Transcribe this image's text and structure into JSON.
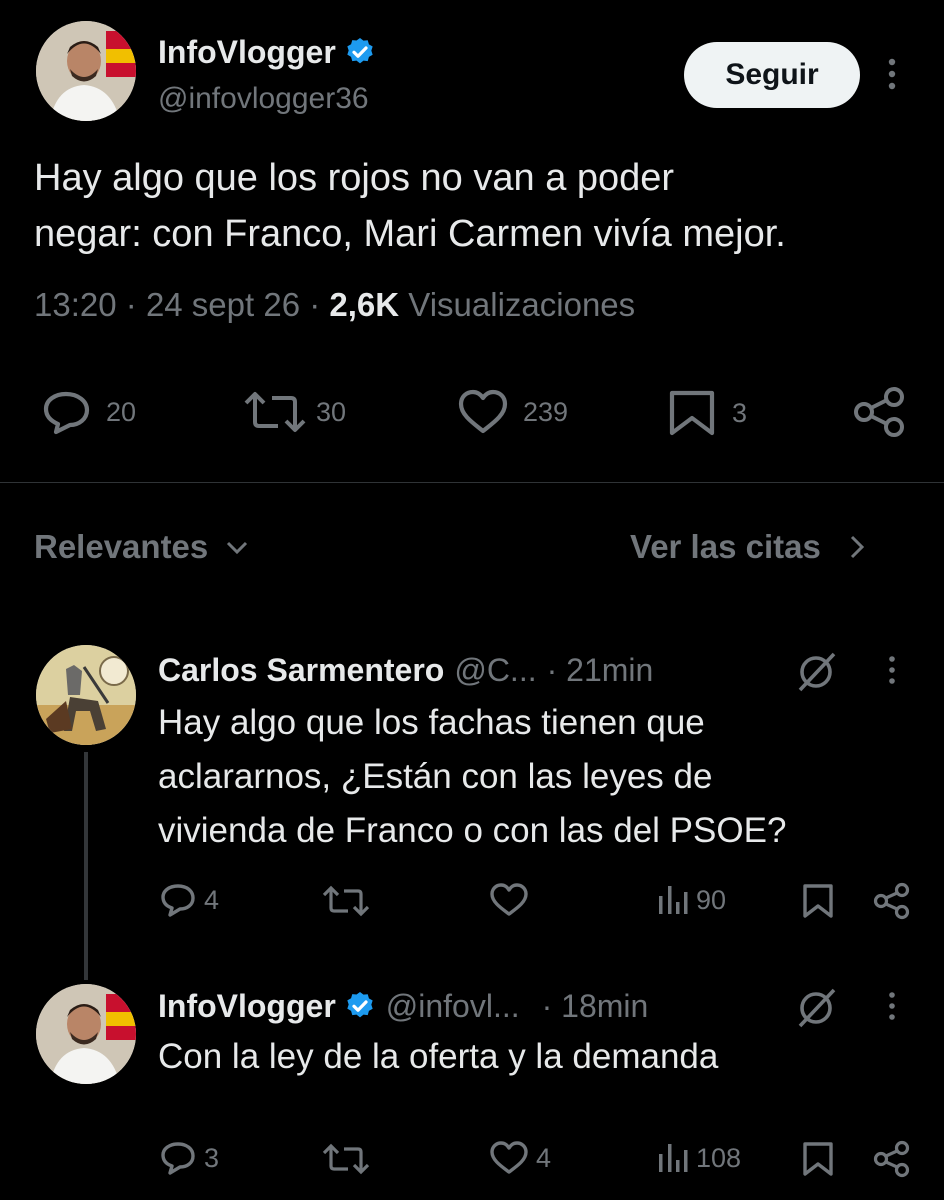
{
  "tweet": {
    "author_name": "InfoVlogger",
    "handle": "@infovlogger36",
    "follow_label": "Seguir",
    "text_line1": "Hay algo que los rojos no van a poder",
    "text_line2": "negar: con Franco, Mari Carmen vivía mejor.",
    "time": "13:20",
    "date": "24 sept 26",
    "views_count": "2,6K",
    "views_label": "Visualizaciones",
    "separator": "·",
    "actions": {
      "replies": "20",
      "retweets": "30",
      "likes": "239",
      "bookmarks": "3"
    }
  },
  "sort": {
    "label": "Relevantes",
    "quotes_label": "Ver las citas"
  },
  "replies": [
    {
      "author_name": "Carlos Sarmentero",
      "handle": "@C...",
      "time": "· 21min",
      "text_lines": [
        "Hay algo que los fachas tienen que",
        "aclararnos, ¿Están con las leyes de",
        "vivienda de Franco o con las del PSOE?"
      ],
      "replies": "4",
      "retweets": "",
      "likes": "",
      "views": "90"
    },
    {
      "author_name": "InfoVlogger",
      "handle": "@infovl...",
      "time": "· 18min",
      "text_lines": [
        "Con la ley de la oferta y la demanda"
      ],
      "replies": "3",
      "retweets": "",
      "likes": "4",
      "views": "108"
    }
  ],
  "colors": {
    "background": "#000000",
    "text": "#e7e9ea",
    "muted": "#71767b",
    "verified": "#1d9bf0",
    "divider": "#2f3336"
  }
}
